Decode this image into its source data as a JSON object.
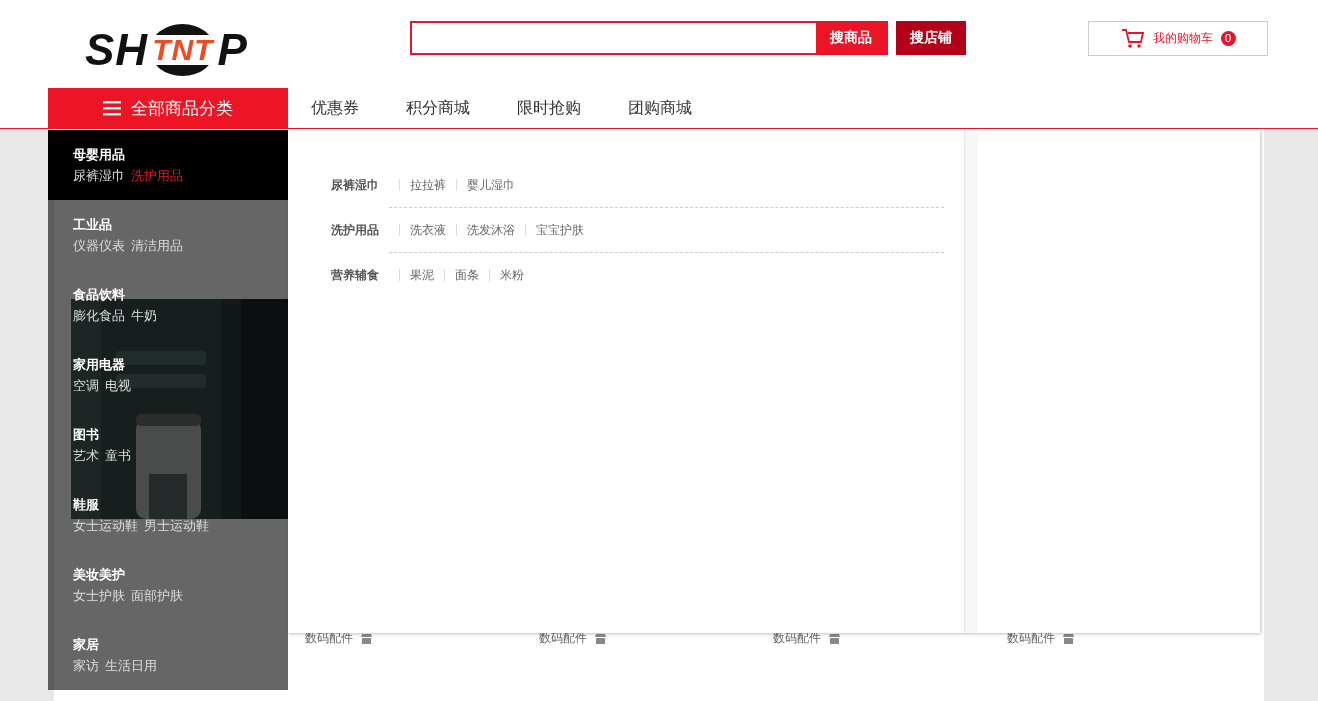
{
  "logo": {
    "parts": [
      "SH",
      "TNT",
      "P"
    ]
  },
  "search": {
    "buttons": [
      "搜商品",
      "搜店铺"
    ]
  },
  "cart": {
    "label": "我的购物车",
    "count": "0"
  },
  "nav": {
    "all_categories": "全部商品分类",
    "links": [
      "优惠券",
      "积分商城",
      "限时抢购",
      "团购商城"
    ]
  },
  "categories": [
    {
      "name": "母婴用品",
      "selected": true,
      "subs": [
        {
          "label": "尿裤湿巾",
          "selected": false
        },
        {
          "label": "洗护用品",
          "selected": true
        }
      ]
    },
    {
      "name": "工业品",
      "selected": false,
      "subs": [
        {
          "label": "仪器仪表",
          "selected": false
        },
        {
          "label": "清洁用品",
          "selected": false
        }
      ]
    },
    {
      "name": "食品饮料",
      "selected": false,
      "subs": [
        {
          "label": "膨化食品",
          "selected": false
        },
        {
          "label": "牛奶",
          "selected": false
        }
      ]
    },
    {
      "name": "家用电器",
      "selected": false,
      "subs": [
        {
          "label": "空调",
          "selected": false
        },
        {
          "label": "电视",
          "selected": false
        }
      ]
    },
    {
      "name": "图书",
      "selected": false,
      "subs": [
        {
          "label": "艺术",
          "selected": false
        },
        {
          "label": "童书",
          "selected": false
        }
      ]
    },
    {
      "name": "鞋服",
      "selected": false,
      "subs": [
        {
          "label": "女士运动鞋",
          "selected": false
        },
        {
          "label": "男士运动鞋",
          "selected": false
        }
      ]
    },
    {
      "name": "美妆美护",
      "selected": false,
      "subs": [
        {
          "label": "女士护肤",
          "selected": false
        },
        {
          "label": "面部护肤",
          "selected": false
        }
      ]
    },
    {
      "name": "家居",
      "selected": false,
      "subs": [
        {
          "label": "家访",
          "selected": false
        },
        {
          "label": "生活日用",
          "selected": false
        }
      ]
    }
  ],
  "panel": {
    "groups": [
      {
        "title": "尿裤湿巾",
        "links": [
          "拉拉裤",
          "婴儿湿巾"
        ]
      },
      {
        "title": "洗护用品",
        "links": [
          "洗衣液",
          "洗发沐浴",
          "宝宝护肤"
        ]
      },
      {
        "title": "营养辅食",
        "links": [
          "果泥",
          "面条",
          "米粉"
        ]
      }
    ]
  },
  "product_tags": [
    "数码配件",
    "数码配件",
    "数码配件",
    "数码配件"
  ]
}
